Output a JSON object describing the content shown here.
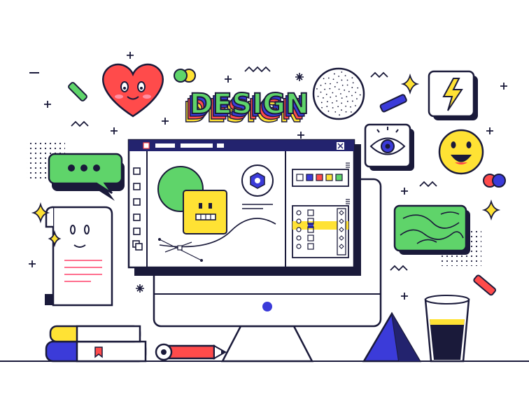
{
  "illustration": {
    "headline": "DESIGN",
    "colors": {
      "ink": "#1a1a3a",
      "navy": "#23236e",
      "blue": "#3b3bd9",
      "green": "#5fd46a",
      "yellow": "#ffe234",
      "red": "#ff4b4b",
      "pink": "#ff6f8e",
      "white": "#ffffff"
    },
    "swatches": [
      "#ffffff",
      "#3b3bd9",
      "#ff4b4b",
      "#ffe234",
      "#5fd46a"
    ],
    "icons": [
      "heart-face-icon",
      "smiley-face-icon",
      "lightning-bolt-icon",
      "eye-icon",
      "chat-bubble-icon",
      "document-face-icon",
      "cube-face-icon",
      "hex-nut-icon",
      "pencil-icon",
      "books-icon",
      "pyramid-icon",
      "glass-icon",
      "topography-card-icon",
      "dotted-sphere-icon",
      "sparkle-icon"
    ]
  }
}
